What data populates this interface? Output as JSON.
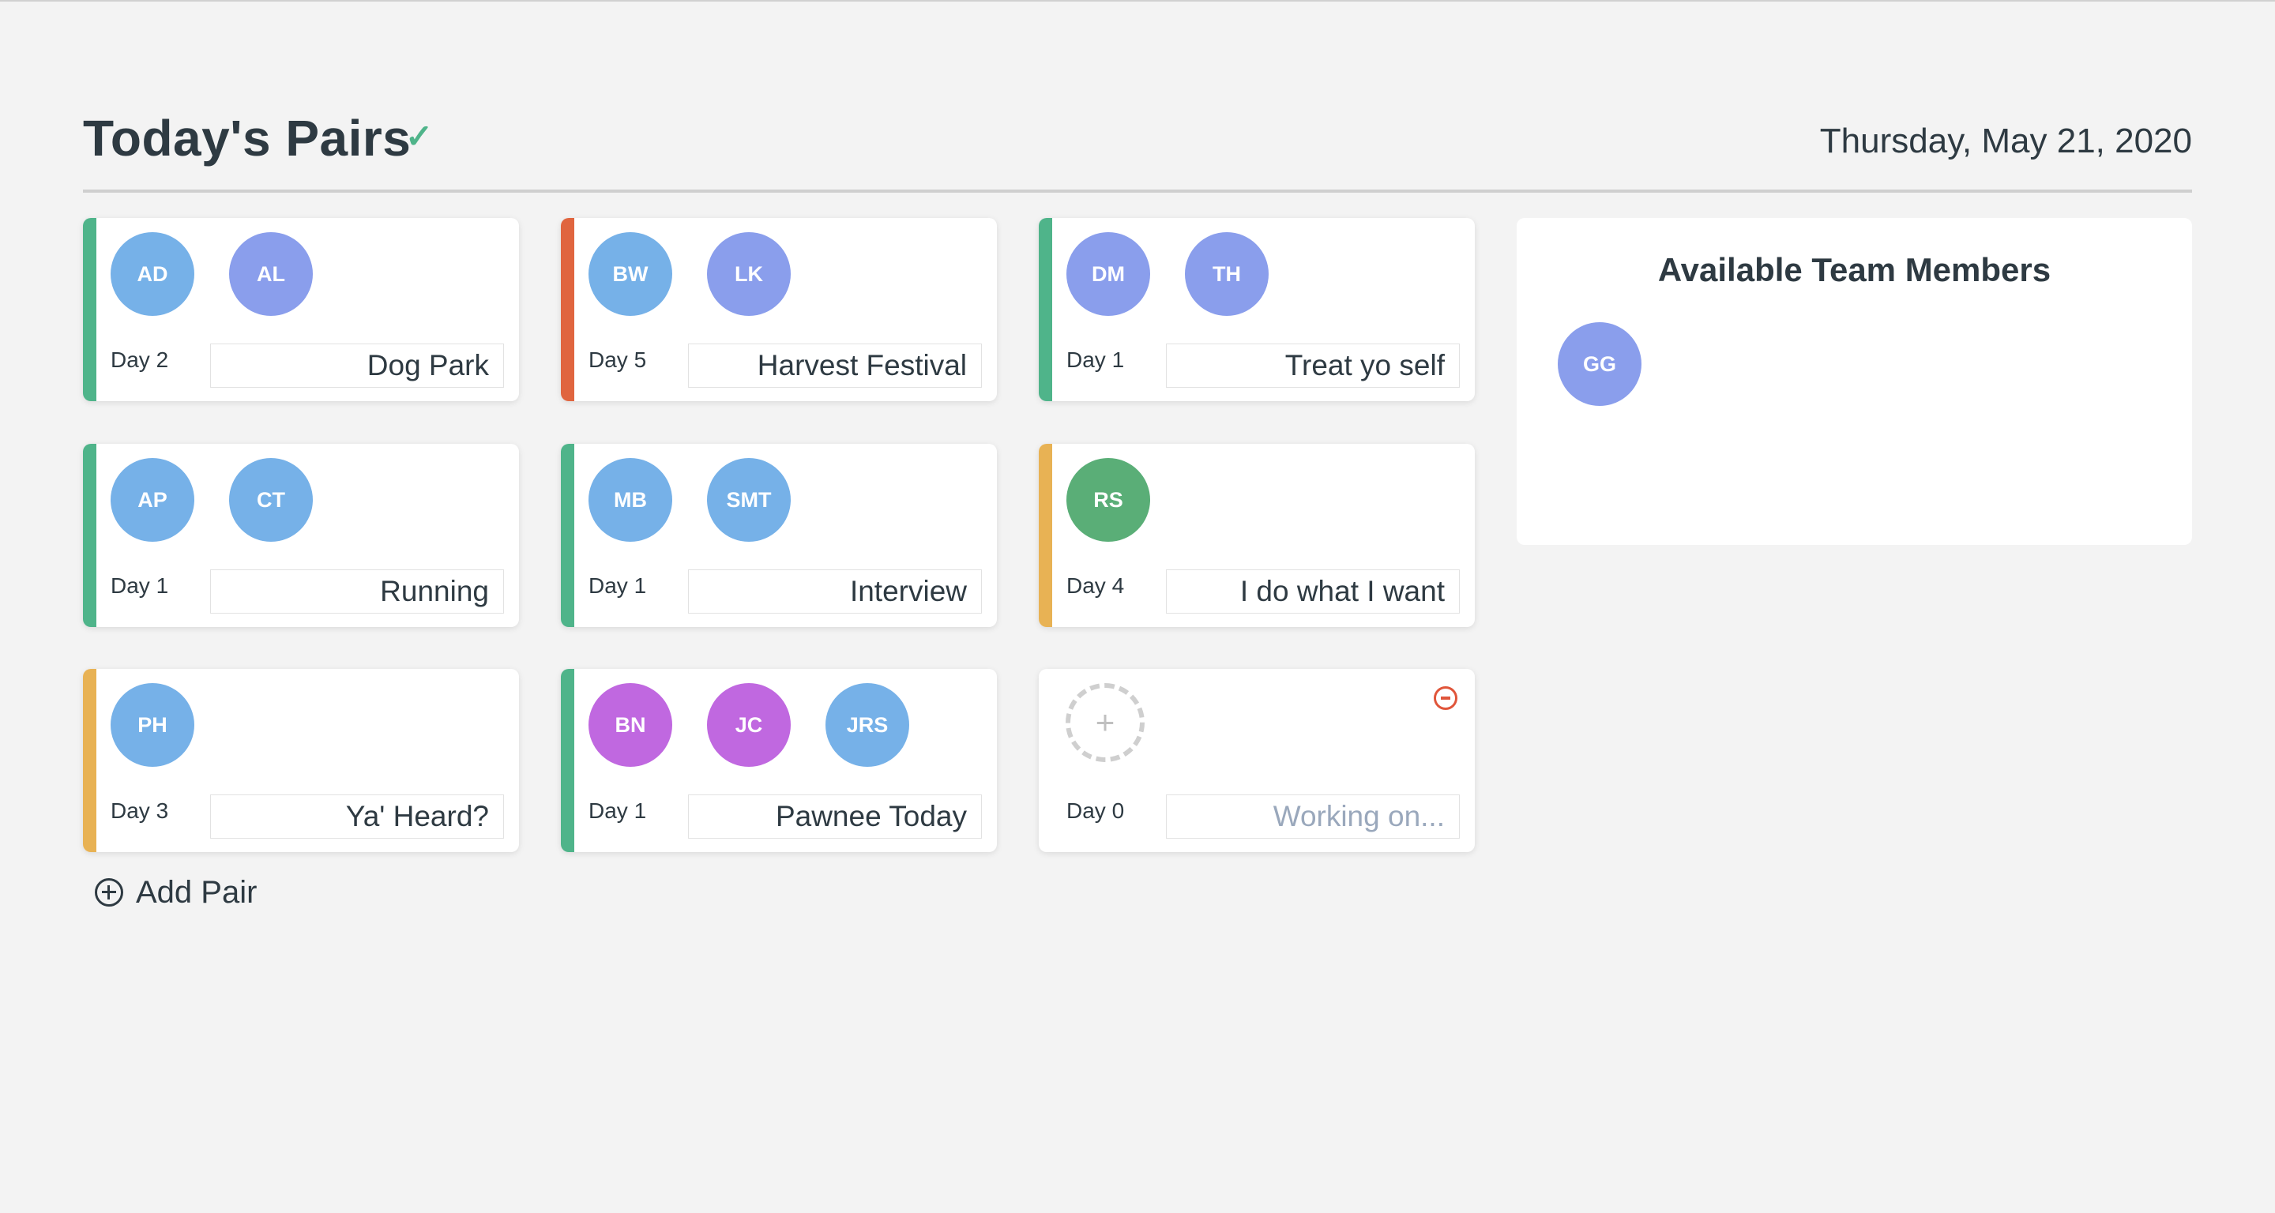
{
  "header": {
    "title": "Today's Pairs",
    "check_icon": "check-icon",
    "date": "Thursday, May 21, 2020"
  },
  "colors": {
    "green": "#4fb48a",
    "red": "#e0653f",
    "yellow": "#e8b254",
    "avatar_blue": "#76b1e8",
    "avatar_indigo": "#8a9eec",
    "avatar_green": "#5aae77",
    "avatar_purple": "#c068e0"
  },
  "pairs": [
    {
      "members": [
        "AD",
        "AL"
      ],
      "day": "Day 2",
      "project": "Dog Park"
    },
    {
      "members": [
        "BW",
        "LK"
      ],
      "day": "Day 5",
      "project": "Harvest Festival"
    },
    {
      "members": [
        "DM",
        "TH"
      ],
      "day": "Day 1",
      "project": "Treat yo self"
    },
    {
      "members": [
        "AP",
        "CT"
      ],
      "day": "Day 1",
      "project": "Running"
    },
    {
      "members": [
        "MB",
        "SMT"
      ],
      "day": "Day 1",
      "project": "Interview"
    },
    {
      "members": [
        "RS"
      ],
      "day": "Day 4",
      "project": "I do what I want"
    },
    {
      "members": [
        "PH"
      ],
      "day": "Day 3",
      "project": "Ya' Heard?"
    },
    {
      "members": [
        "BN",
        "JC",
        "JRS"
      ],
      "day": "Day 1",
      "project": "Pawnee Today"
    },
    {
      "members": [],
      "day": "Day 0",
      "project": "",
      "placeholder": "Working on..."
    }
  ],
  "add_pair": {
    "label": "Add Pair"
  },
  "available": {
    "title": "Available Team Members",
    "members": [
      "GG"
    ]
  }
}
